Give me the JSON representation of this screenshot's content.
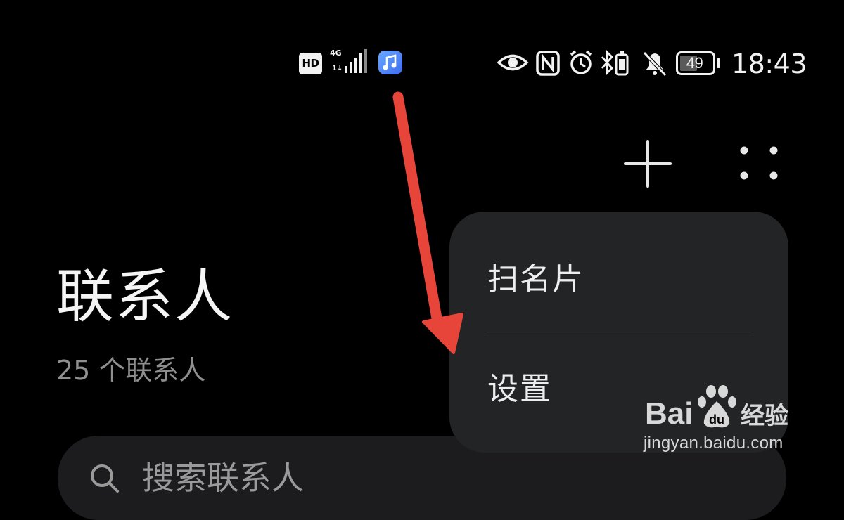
{
  "status_bar": {
    "hd_label": "HD",
    "network_label": "4G",
    "battery_level": "49",
    "time": "18:43",
    "icons": [
      "hd-badge",
      "4g-signal-icon",
      "music-app-icon",
      "eye-icon",
      "nfc-icon",
      "alarm-icon",
      "bluetooth-icon",
      "vibrate-icon",
      "mute-bell-icon",
      "battery-icon"
    ]
  },
  "header": {
    "add_icon": "plus-icon",
    "more_icon": "more-dots-icon"
  },
  "page": {
    "title": "联系人",
    "count_text": "25 个联系人"
  },
  "search": {
    "placeholder": "搜索联系人",
    "icon": "search-icon"
  },
  "menu": {
    "items": [
      {
        "label": "扫名片"
      },
      {
        "label": "设置"
      }
    ]
  },
  "watermark": {
    "brand": "Baidu经验",
    "url": "jingyan.baidu.com"
  },
  "colors": {
    "background": "#000000",
    "menu_background": "#232426",
    "annotation_arrow": "#e8453a",
    "secondary_text": "#8f8f8f"
  }
}
